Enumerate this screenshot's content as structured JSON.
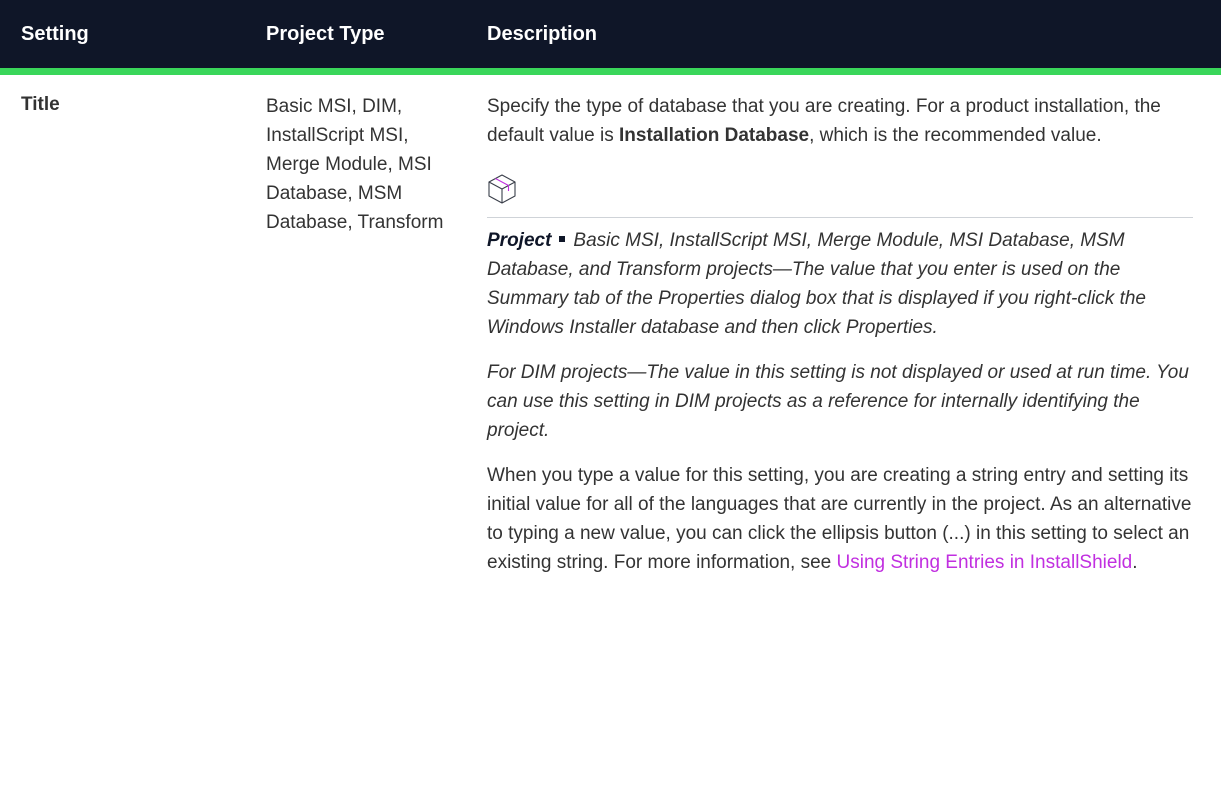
{
  "header": {
    "col1": "Setting",
    "col2": "Project Type",
    "col3": "Description"
  },
  "row": {
    "setting": "Title",
    "project_type": "Basic MSI, DIM, InstallScript MSI, Merge Module, MSI Database, MSM Database, Transform",
    "desc_intro_1": "Specify the type of database that you are creating. For a product installation, the default value is ",
    "desc_intro_bold": "Installation Database",
    "desc_intro_2": ", which is the recommended value.",
    "note_icon": "project-box-icon",
    "note_label": "Project",
    "note_text_1": "Basic MSI, InstallScript MSI, Merge Module, MSI Database, MSM Database, and Transform projects—The value that you enter is used on the Summary tab of the Properties dialog box that is displayed if you right-click the Windows Installer database and then click Properties.",
    "note_text_2": "For DIM projects—The value in this setting is not displayed or used at run time. You can use this setting in DIM projects as a reference for internally identifying the project.",
    "desc_final_1": "When you type a value for this setting, you are creating a string entry and setting its initial value for all of the languages that are currently in the project. As an alternative to typing a new value, you can click the ellipsis button (...) in this setting to select an existing string. For more information, see ",
    "desc_final_link": "Using String Entries in InstallShield",
    "desc_final_2": "."
  },
  "colors": {
    "header_bg": "#0f1628",
    "header_rule": "#3ad65a",
    "link": "#c12fe0"
  }
}
